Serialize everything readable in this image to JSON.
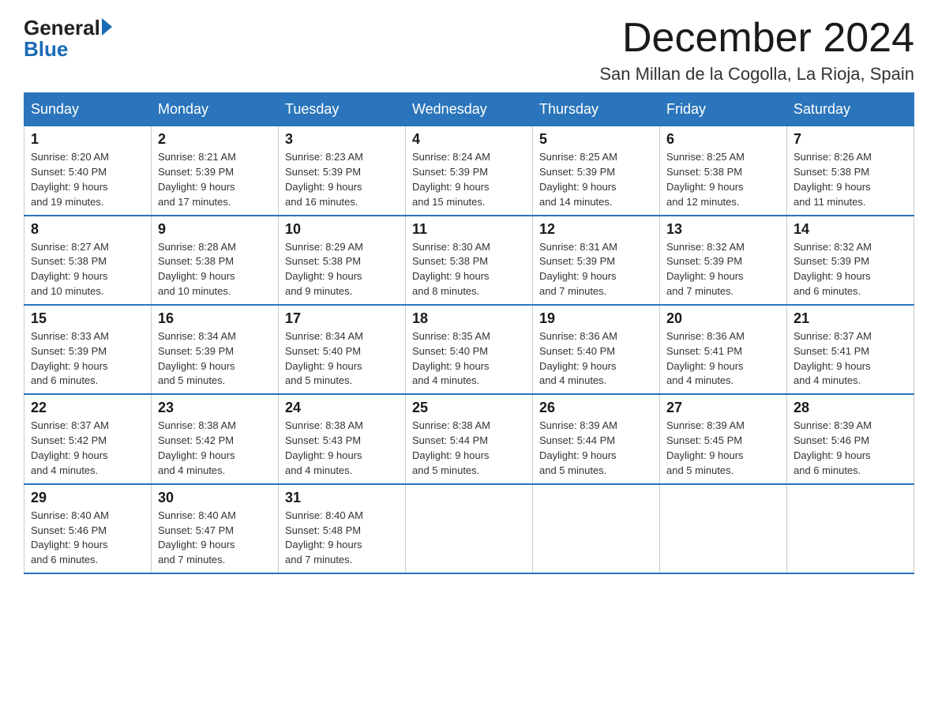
{
  "header": {
    "logo_general": "General",
    "logo_blue": "Blue",
    "month_title": "December 2024",
    "location": "San Millan de la Cogolla, La Rioja, Spain"
  },
  "days_of_week": [
    "Sunday",
    "Monday",
    "Tuesday",
    "Wednesday",
    "Thursday",
    "Friday",
    "Saturday"
  ],
  "weeks": [
    [
      {
        "day": "1",
        "sunrise": "8:20 AM",
        "sunset": "5:40 PM",
        "daylight": "9 hours and 19 minutes."
      },
      {
        "day": "2",
        "sunrise": "8:21 AM",
        "sunset": "5:39 PM",
        "daylight": "9 hours and 17 minutes."
      },
      {
        "day": "3",
        "sunrise": "8:23 AM",
        "sunset": "5:39 PM",
        "daylight": "9 hours and 16 minutes."
      },
      {
        "day": "4",
        "sunrise": "8:24 AM",
        "sunset": "5:39 PM",
        "daylight": "9 hours and 15 minutes."
      },
      {
        "day": "5",
        "sunrise": "8:25 AM",
        "sunset": "5:39 PM",
        "daylight": "9 hours and 14 minutes."
      },
      {
        "day": "6",
        "sunrise": "8:25 AM",
        "sunset": "5:38 PM",
        "daylight": "9 hours and 12 minutes."
      },
      {
        "day": "7",
        "sunrise": "8:26 AM",
        "sunset": "5:38 PM",
        "daylight": "9 hours and 11 minutes."
      }
    ],
    [
      {
        "day": "8",
        "sunrise": "8:27 AM",
        "sunset": "5:38 PM",
        "daylight": "9 hours and 10 minutes."
      },
      {
        "day": "9",
        "sunrise": "8:28 AM",
        "sunset": "5:38 PM",
        "daylight": "9 hours and 10 minutes."
      },
      {
        "day": "10",
        "sunrise": "8:29 AM",
        "sunset": "5:38 PM",
        "daylight": "9 hours and 9 minutes."
      },
      {
        "day": "11",
        "sunrise": "8:30 AM",
        "sunset": "5:38 PM",
        "daylight": "9 hours and 8 minutes."
      },
      {
        "day": "12",
        "sunrise": "8:31 AM",
        "sunset": "5:39 PM",
        "daylight": "9 hours and 7 minutes."
      },
      {
        "day": "13",
        "sunrise": "8:32 AM",
        "sunset": "5:39 PM",
        "daylight": "9 hours and 7 minutes."
      },
      {
        "day": "14",
        "sunrise": "8:32 AM",
        "sunset": "5:39 PM",
        "daylight": "9 hours and 6 minutes."
      }
    ],
    [
      {
        "day": "15",
        "sunrise": "8:33 AM",
        "sunset": "5:39 PM",
        "daylight": "9 hours and 6 minutes."
      },
      {
        "day": "16",
        "sunrise": "8:34 AM",
        "sunset": "5:39 PM",
        "daylight": "9 hours and 5 minutes."
      },
      {
        "day": "17",
        "sunrise": "8:34 AM",
        "sunset": "5:40 PM",
        "daylight": "9 hours and 5 minutes."
      },
      {
        "day": "18",
        "sunrise": "8:35 AM",
        "sunset": "5:40 PM",
        "daylight": "9 hours and 4 minutes."
      },
      {
        "day": "19",
        "sunrise": "8:36 AM",
        "sunset": "5:40 PM",
        "daylight": "9 hours and 4 minutes."
      },
      {
        "day": "20",
        "sunrise": "8:36 AM",
        "sunset": "5:41 PM",
        "daylight": "9 hours and 4 minutes."
      },
      {
        "day": "21",
        "sunrise": "8:37 AM",
        "sunset": "5:41 PM",
        "daylight": "9 hours and 4 minutes."
      }
    ],
    [
      {
        "day": "22",
        "sunrise": "8:37 AM",
        "sunset": "5:42 PM",
        "daylight": "9 hours and 4 minutes."
      },
      {
        "day": "23",
        "sunrise": "8:38 AM",
        "sunset": "5:42 PM",
        "daylight": "9 hours and 4 minutes."
      },
      {
        "day": "24",
        "sunrise": "8:38 AM",
        "sunset": "5:43 PM",
        "daylight": "9 hours and 4 minutes."
      },
      {
        "day": "25",
        "sunrise": "8:38 AM",
        "sunset": "5:44 PM",
        "daylight": "9 hours and 5 minutes."
      },
      {
        "day": "26",
        "sunrise": "8:39 AM",
        "sunset": "5:44 PM",
        "daylight": "9 hours and 5 minutes."
      },
      {
        "day": "27",
        "sunrise": "8:39 AM",
        "sunset": "5:45 PM",
        "daylight": "9 hours and 5 minutes."
      },
      {
        "day": "28",
        "sunrise": "8:39 AM",
        "sunset": "5:46 PM",
        "daylight": "9 hours and 6 minutes."
      }
    ],
    [
      {
        "day": "29",
        "sunrise": "8:40 AM",
        "sunset": "5:46 PM",
        "daylight": "9 hours and 6 minutes."
      },
      {
        "day": "30",
        "sunrise": "8:40 AM",
        "sunset": "5:47 PM",
        "daylight": "9 hours and 7 minutes."
      },
      {
        "day": "31",
        "sunrise": "8:40 AM",
        "sunset": "5:48 PM",
        "daylight": "9 hours and 7 minutes."
      },
      null,
      null,
      null,
      null
    ]
  ],
  "labels": {
    "sunrise": "Sunrise:",
    "sunset": "Sunset:",
    "daylight": "Daylight:"
  }
}
